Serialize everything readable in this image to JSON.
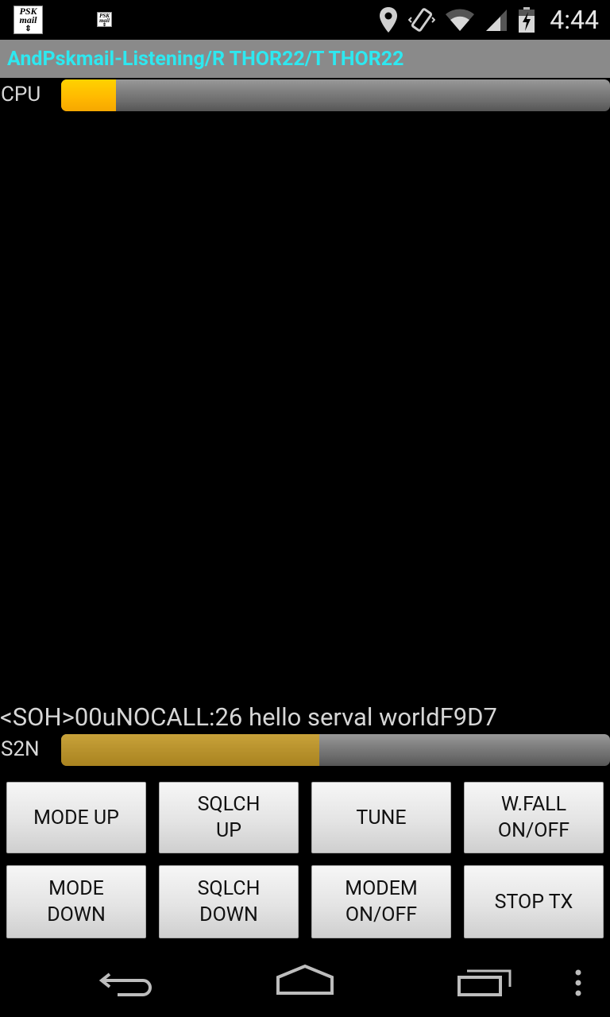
{
  "status_bar": {
    "left_icons": [
      {
        "name": "pskmail-app-icon",
        "line1": "PSK",
        "line2": "mail"
      },
      {
        "name": "pskmail-small-icon",
        "line1": "PSK",
        "line2": "mail"
      }
    ],
    "right_icons": [
      "location-icon",
      "vibrate-icon",
      "wifi-icon",
      "signal-icon",
      "battery-charging-icon"
    ],
    "time": "4:44"
  },
  "title": "AndPskmail-Listening/R THOR22/T THOR22",
  "cpu": {
    "label": "CPU",
    "level": 0.1
  },
  "received_text": "<SOH>00uNOCALL:26 hello serval worldF9D7",
  "s2n": {
    "label": "S2N",
    "level": 0.47
  },
  "buttons": {
    "row1": [
      {
        "line1": "MODE UP",
        "line2": ""
      },
      {
        "line1": "SQLCH",
        "line2": "UP"
      },
      {
        "line1": "TUNE",
        "line2": ""
      },
      {
        "line1": "W.FALL",
        "line2": "ON/OFF"
      }
    ],
    "row2": [
      {
        "line1": "MODE",
        "line2": "DOWN"
      },
      {
        "line1": "SQLCH",
        "line2": "DOWN"
      },
      {
        "line1": "MODEM",
        "line2": "ON/OFF"
      },
      {
        "line1": "STOP TX",
        "line2": ""
      }
    ]
  },
  "nav": [
    "back-icon",
    "home-icon",
    "recents-icon",
    "overflow-menu-icon"
  ],
  "colors": {
    "title_text": "#2ee8f0",
    "title_bg": "#8a8a8a",
    "cpu_fill": "#ffc000",
    "s2n_fill": "#b8922c"
  }
}
